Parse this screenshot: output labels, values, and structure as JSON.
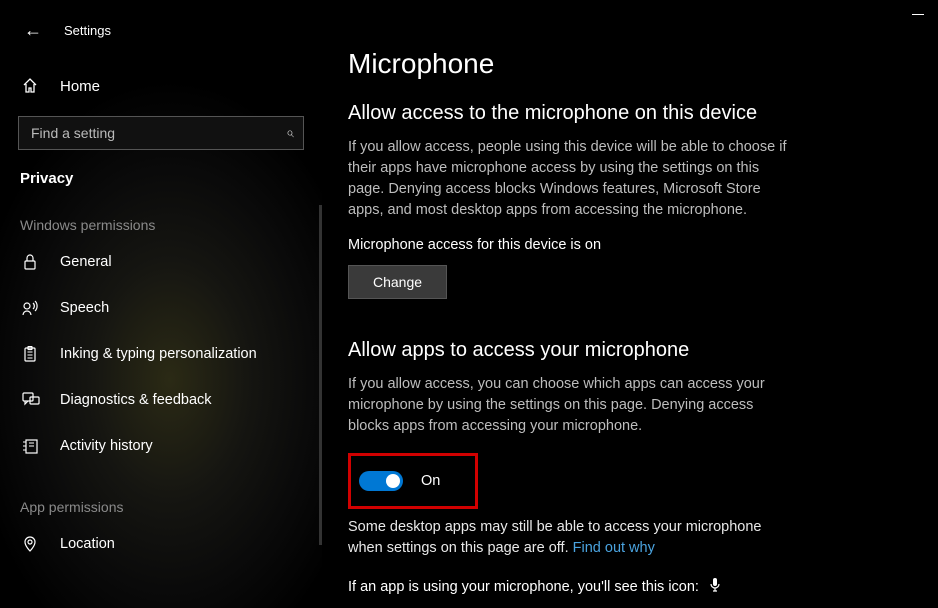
{
  "window": {
    "title": "Settings"
  },
  "sidebar": {
    "home": "Home",
    "search_placeholder": "Find a setting",
    "category": "Privacy",
    "section_windows": "Windows permissions",
    "items_win": [
      {
        "icon": "lock",
        "label": "General"
      },
      {
        "icon": "speech",
        "label": "Speech"
      },
      {
        "icon": "inking",
        "label": "Inking & typing personalization"
      },
      {
        "icon": "diag",
        "label": "Diagnostics & feedback"
      },
      {
        "icon": "history",
        "label": "Activity history"
      }
    ],
    "section_app": "App permissions",
    "items_app": [
      {
        "icon": "location",
        "label": "Location"
      }
    ]
  },
  "main": {
    "title": "Microphone",
    "section1": {
      "heading": "Allow access to the microphone on this device",
      "body": "If you allow access, people using this device will be able to choose if their apps have microphone access by using the settings on this page. Denying access blocks Windows features, Microsoft Store apps, and most desktop apps from accessing the microphone.",
      "status": "Microphone access for this device is on",
      "button": "Change"
    },
    "section2": {
      "heading": "Allow apps to access your microphone",
      "body": "If you allow access, you can choose which apps can access your microphone by using the settings on this page. Denying access blocks apps from accessing your microphone.",
      "toggle_state": "On",
      "note_prefix": "Some desktop apps may still be able to access your microphone when settings on this page are off. ",
      "note_link": "Find out why",
      "icon_line": "If an app is using your microphone, you'll see this icon:"
    }
  }
}
